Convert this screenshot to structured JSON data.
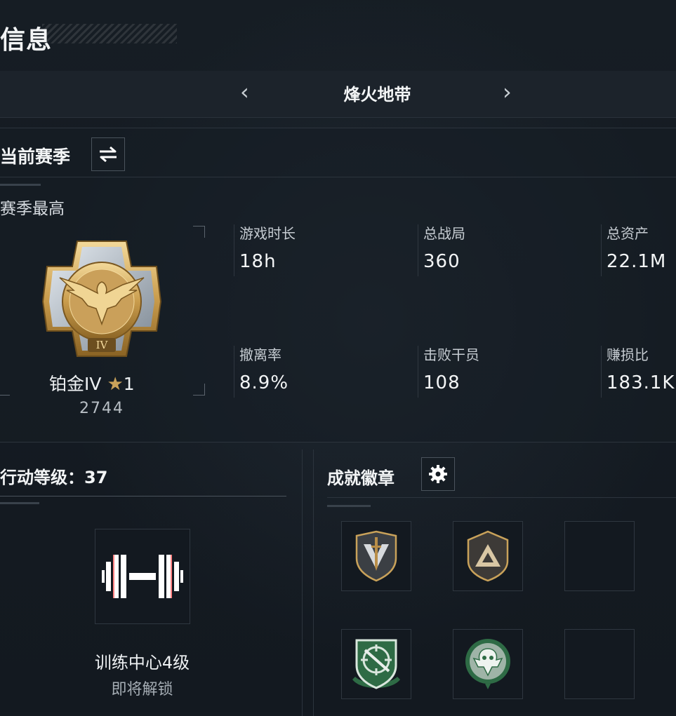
{
  "header": {
    "title": "信息"
  },
  "mode_selector": {
    "current": "烽火地带",
    "prev_glyph": "‹",
    "next_glyph": "›"
  },
  "season": {
    "title": "当前赛季",
    "subtitle": "赛季最高",
    "rank": {
      "name": "铂金IV",
      "stars": "1",
      "score": "2744",
      "tier_numeral": "IV"
    },
    "stats": [
      {
        "label": "游戏时长",
        "value": "18h"
      },
      {
        "label": "总战局",
        "value": "360"
      },
      {
        "label": "总资产",
        "value": "22.1M"
      },
      {
        "label": "撤离率",
        "value": "8.9%"
      },
      {
        "label": "击败干员",
        "value": "108"
      },
      {
        "label": "赚损比",
        "value": "183.1K"
      }
    ]
  },
  "level": {
    "title": "行动等级：37",
    "facility": "训练中心4级",
    "status": "即将解锁"
  },
  "badges": {
    "title": "成就徽章",
    "slots": [
      "sword-shield-badge",
      "triangle-shield-badge",
      "empty",
      "sniper-shield-badge",
      "crest-medal-badge",
      "empty"
    ]
  },
  "colors": {
    "background": "#141a21",
    "gold": "#c9a25a",
    "green_badge": "#2e6b45"
  }
}
